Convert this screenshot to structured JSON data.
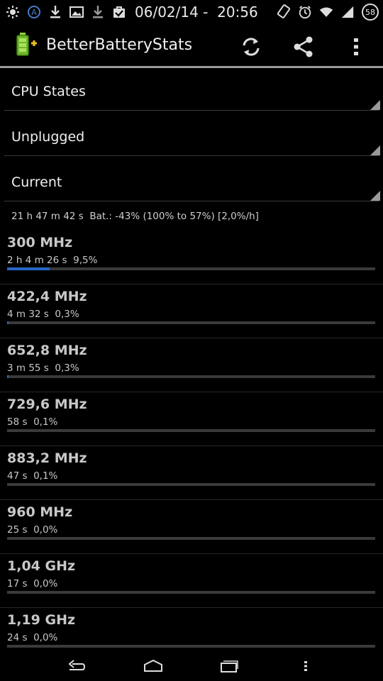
{
  "status_bar": {
    "datetime": "06/02/14 -  20:56",
    "battery_level": "58",
    "left_icons": [
      "brightness-icon",
      "a-circle-icon",
      "download-icon",
      "image-icon",
      "download-icon",
      "checkbox-bag-icon"
    ],
    "right_icons": [
      "rotate-icon",
      "alarm-icon",
      "wifi-icon",
      "signal-icon"
    ]
  },
  "action_bar": {
    "title": "BetterBatteryStats",
    "actions": [
      "refresh-icon",
      "share-icon",
      "overflow-menu-icon"
    ]
  },
  "spinners": [
    {
      "label": "CPU States"
    },
    {
      "label": "Unplugged"
    },
    {
      "label": "Current"
    }
  ],
  "summary": "21 h 47 m 42 s  Bat.: -43% (100% to 57%) [2,0%/h]",
  "cpu_states": [
    {
      "freq": "300 MHz",
      "stats": "2 h 4 m 26 s  9,5%",
      "fraction": 0.115
    },
    {
      "freq": "422,4 MHz",
      "stats": "4 m 32 s  0,3%",
      "fraction": 0.004
    },
    {
      "freq": "652,8 MHz",
      "stats": "3 m 55 s  0,3%",
      "fraction": 0.004
    },
    {
      "freq": "729,6 MHz",
      "stats": "58 s  0,1%",
      "fraction": 0
    },
    {
      "freq": "883,2 MHz",
      "stats": "47 s  0,1%",
      "fraction": 0
    },
    {
      "freq": "960 MHz",
      "stats": "25 s  0,0%",
      "fraction": 0
    },
    {
      "freq": "1,04 GHz",
      "stats": "17 s  0,0%",
      "fraction": 0
    },
    {
      "freq": "1,19 GHz",
      "stats": "24 s  0,0%",
      "fraction": 0
    }
  ],
  "nav_bar": [
    "back-icon",
    "home-icon",
    "recent-apps-icon",
    "menu-icon"
  ],
  "colors": {
    "accent": "#2866c8",
    "background": "#000000",
    "text": "#c8c8c8"
  }
}
